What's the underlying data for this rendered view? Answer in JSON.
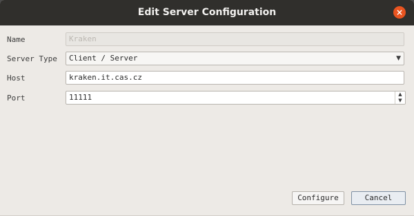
{
  "window": {
    "title": "Edit Server Configuration",
    "close_glyph": "×"
  },
  "form": {
    "name": {
      "label": "Name",
      "value": "Kraken",
      "enabled": false
    },
    "server_type": {
      "label": "Server Type",
      "value": "Client / Server",
      "arrow_glyph": "▼"
    },
    "host": {
      "label": "Host",
      "value": "kraken.it.cas.cz"
    },
    "port": {
      "label": "Port",
      "value": "11111",
      "up_glyph": "▲",
      "down_glyph": "▼"
    }
  },
  "buttons": {
    "configure": "Configure",
    "cancel": "Cancel"
  },
  "colors": {
    "titlebar": "#302f2c",
    "close_button": "#e95420",
    "dialog_background": "#edeae6"
  }
}
